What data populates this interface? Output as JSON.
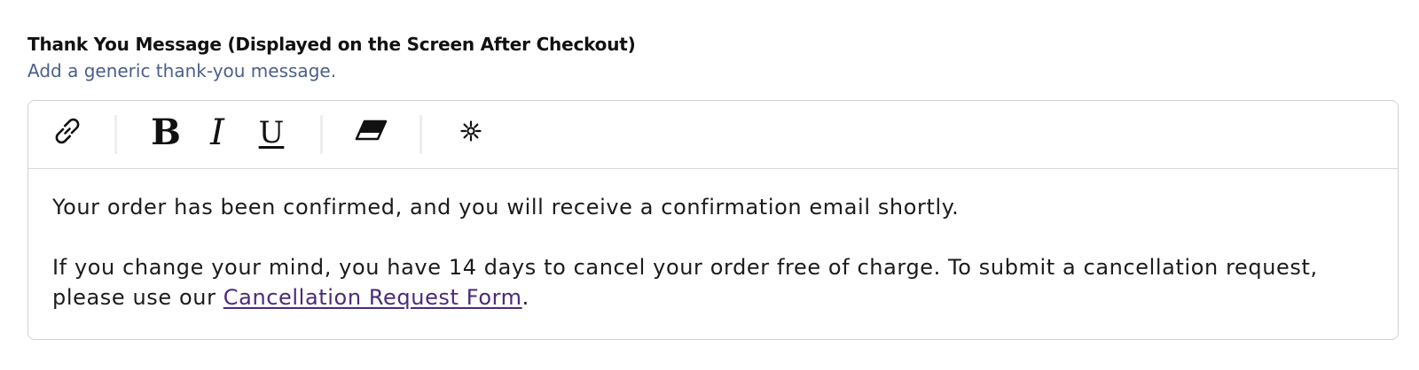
{
  "field": {
    "title": "Thank You Message (Displayed on the Screen After Checkout)",
    "help": "Add a generic thank-you message."
  },
  "toolbar": {
    "link_icon": "link-icon",
    "bold_label": "B",
    "italic_label": "I",
    "underline_label": "U",
    "eraser_icon": "eraser-icon",
    "special_icon": "asterisk-sun-icon"
  },
  "editor": {
    "paragraph_1": "Your order has been confirmed, and you will receive a confirmation email shortly.",
    "paragraph_2_text": "If you change your mind, you have 14 days to cancel your order free of charge. To submit a cancellation request, please use our ",
    "paragraph_2_link": "Cancellation Request Form",
    "paragraph_2_end": "."
  },
  "colors": {
    "help_text": "#4a5f8a",
    "link": "#4b2a7a",
    "border": "#cfd2d6"
  }
}
